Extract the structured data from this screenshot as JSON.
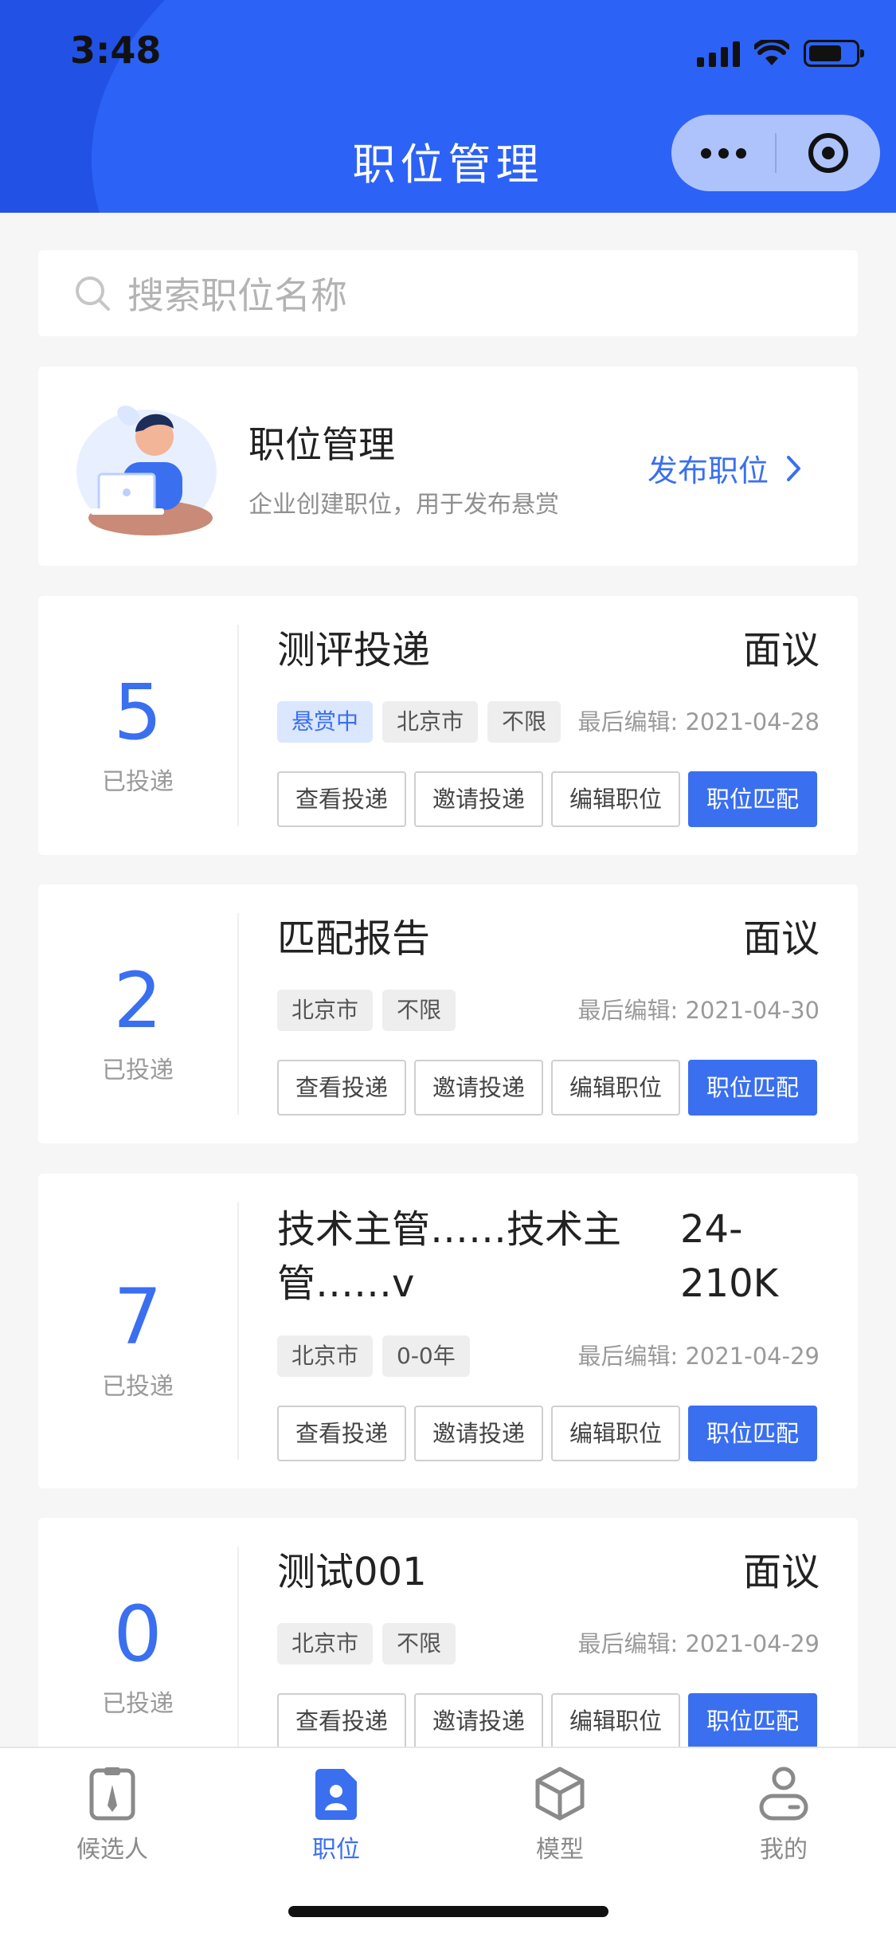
{
  "status_bar": {
    "time": "3:48"
  },
  "header": {
    "title": "职位管理"
  },
  "search": {
    "placeholder": "搜索职位名称"
  },
  "banner": {
    "title": "职位管理",
    "subtitle": "企业创建职位，用于发布悬赏",
    "action_label": "发布职位"
  },
  "jobs": [
    {
      "count": "5",
      "count_label": "已投递",
      "title": "测评投递",
      "salary": "面议",
      "tags": [
        {
          "label": "悬赏中",
          "style": "active"
        },
        {
          "label": "北京市"
        },
        {
          "label": "不限"
        }
      ],
      "edited": "最后编辑: 2021-04-28",
      "actions": [
        "查看投递",
        "邀请投递",
        "编辑职位",
        "职位匹配"
      ]
    },
    {
      "count": "2",
      "count_label": "已投递",
      "title": "匹配报告",
      "salary": "面议",
      "tags": [
        {
          "label": "北京市"
        },
        {
          "label": "不限"
        }
      ],
      "edited": "最后编辑: 2021-04-30",
      "actions": [
        "查看投递",
        "邀请投递",
        "编辑职位",
        "职位匹配"
      ]
    },
    {
      "count": "7",
      "count_label": "已投递",
      "title": "技术主管……技术主管……v",
      "salary": "24-210K",
      "tags": [
        {
          "label": "北京市"
        },
        {
          "label": "0-0年"
        }
      ],
      "edited": "最后编辑: 2021-04-29",
      "actions": [
        "查看投递",
        "邀请投递",
        "编辑职位",
        "职位匹配"
      ]
    },
    {
      "count": "0",
      "count_label": "已投递",
      "title": "测试001",
      "salary": "面议",
      "tags": [
        {
          "label": "北京市"
        },
        {
          "label": "不限"
        }
      ],
      "edited": "最后编辑: 2021-04-29",
      "actions": [
        "查看投递",
        "邀请投递",
        "编辑职位",
        "职位匹配"
      ]
    }
  ],
  "tabbar": {
    "items": [
      {
        "label": "候选人",
        "icon": "resume-icon",
        "active": false
      },
      {
        "label": "职位",
        "icon": "position-icon",
        "active": true
      },
      {
        "label": "模型",
        "icon": "cube-icon",
        "active": false
      },
      {
        "label": "我的",
        "icon": "profile-icon",
        "active": false
      }
    ]
  },
  "colors": {
    "header_blue": "#2251e6",
    "accent": "#3a6ff0",
    "background": "#f6f6f6"
  }
}
